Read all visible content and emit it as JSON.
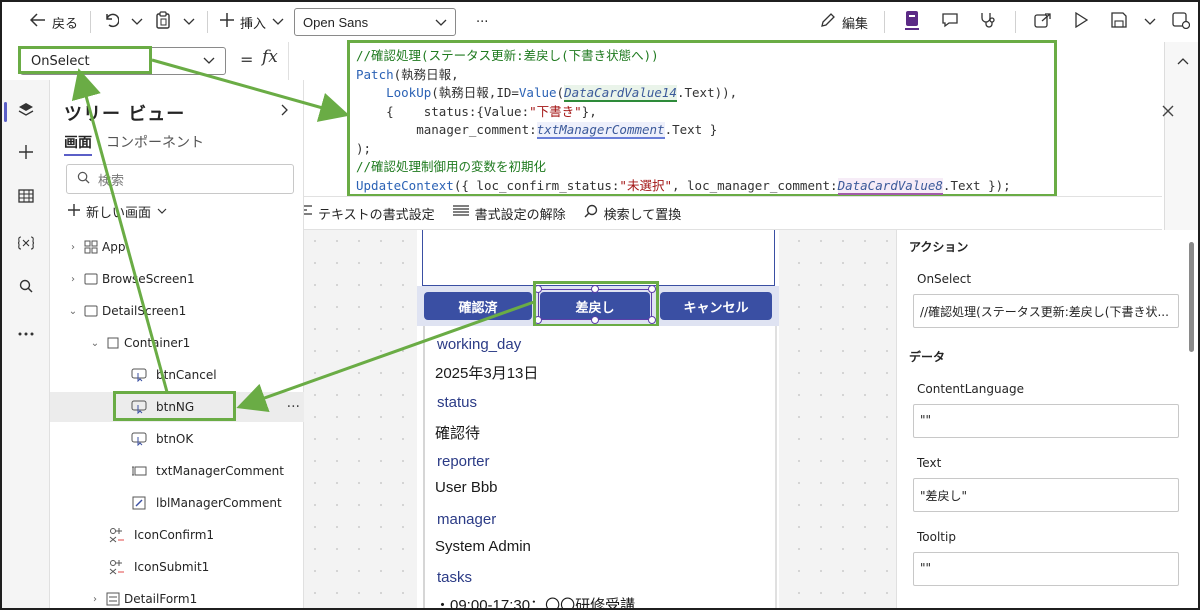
{
  "toolbar": {
    "back_label": "戻る",
    "insert_label": "挿入",
    "font_name": "Open Sans",
    "more_label": "···",
    "edit_label": "編集"
  },
  "formula": {
    "property": "OnSelect",
    "equals": "=",
    "fx": "fx",
    "lines": {
      "l1": "//確認処理(ステータス更新:差戻し(下書き状態へ))",
      "l2_fn": "Patch",
      "l2_rest": "(執務日報,",
      "l3_fn1": "LookUp",
      "l3_a": "(執務日報,ID=",
      "l3_fn2": "Value",
      "l3_b": "(",
      "l3_ctrl": "DataCardValue14",
      "l3_c": ".Text)),",
      "l4_a": "{    status:{Value:",
      "l4_str": "\"下書き\"",
      "l4_b": "},",
      "l5_a": "manager_comment:",
      "l5_ctrl": "txtManagerComment",
      "l5_b": ".Text }",
      "l6": ");",
      "l7": "//確認処理制御用の変数を初期化",
      "l8_fn": "UpdateContext",
      "l8_a": "({ loc_confirm_status:",
      "l8_str": "\"未選択\"",
      "l8_b": ", loc_manager_comment:",
      "l8_ctrl": "DataCardValue8",
      "l8_c": ".Text });"
    },
    "format_text": "テキストの書式設定",
    "remove_format": "書式設定の解除",
    "find_replace": "検索して置換"
  },
  "tree": {
    "title": "ツリー ビュー",
    "tab_screens": "画面",
    "tab_components": "コンポーネント",
    "search_placeholder": "検索",
    "new_screen": "新しい画面",
    "items": [
      {
        "label": "App"
      },
      {
        "label": "BrowseScreen1"
      },
      {
        "label": "DetailScreen1"
      },
      {
        "label": "Container1"
      },
      {
        "label": "btnCancel"
      },
      {
        "label": "btnNG"
      },
      {
        "label": "btnOK"
      },
      {
        "label": "txtManagerComment"
      },
      {
        "label": "lblManagerComment"
      },
      {
        "label": "IconConfirm1"
      },
      {
        "label": "IconSubmit1"
      },
      {
        "label": "DetailForm1"
      }
    ]
  },
  "canvas": {
    "btn_ok": "確認済",
    "btn_ng": "差戻し",
    "btn_cancel": "キャンセル",
    "fields": [
      {
        "label": "working_day",
        "value": "2025年3月13日"
      },
      {
        "label": "status",
        "value": "確認待"
      },
      {
        "label": "reporter",
        "value": "User Bbb"
      },
      {
        "label": "manager",
        "value": "System Admin"
      },
      {
        "label": "tasks",
        "value": "・09:00-17:30：〇〇研修受講"
      }
    ]
  },
  "properties": {
    "section_action": "アクション",
    "onselect_label": "OnSelect",
    "onselect_value": "//確認処理(ステータス更新:差戻し(下書き状...",
    "section_data": "データ",
    "contentlanguage_label": "ContentLanguage",
    "contentlanguage_value": "\"\"",
    "text_label": "Text",
    "text_value": "\"差戻し\"",
    "tooltip_label": "Tooltip",
    "tooltip_value": "\"\""
  },
  "colors": {
    "highlight": "#6aac45",
    "app_button": "#3a4fa3",
    "accent": "#5b5fc7"
  }
}
